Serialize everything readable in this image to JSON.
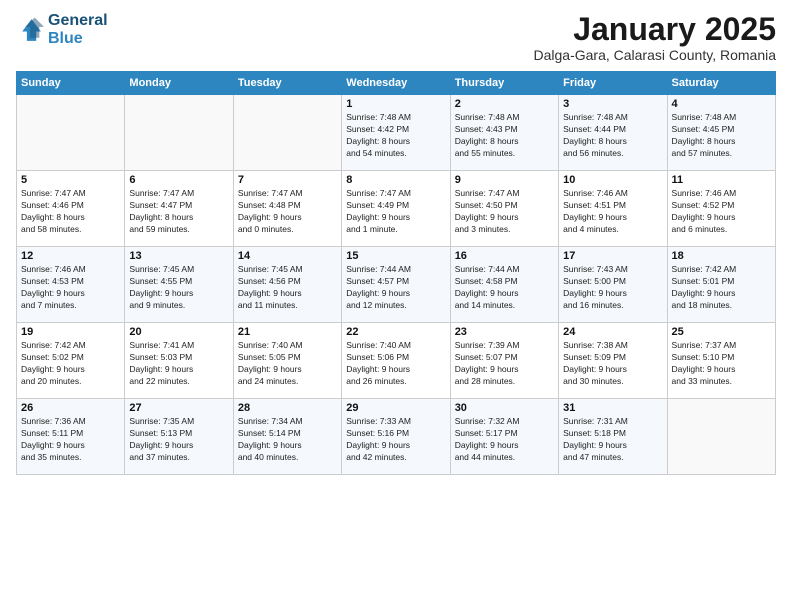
{
  "header": {
    "logo_line1": "General",
    "logo_line2": "Blue",
    "month": "January 2025",
    "location": "Dalga-Gara, Calarasi County, Romania"
  },
  "weekdays": [
    "Sunday",
    "Monday",
    "Tuesday",
    "Wednesday",
    "Thursday",
    "Friday",
    "Saturday"
  ],
  "weeks": [
    [
      {
        "day": "",
        "info": ""
      },
      {
        "day": "",
        "info": ""
      },
      {
        "day": "",
        "info": ""
      },
      {
        "day": "1",
        "info": "Sunrise: 7:48 AM\nSunset: 4:42 PM\nDaylight: 8 hours\nand 54 minutes."
      },
      {
        "day": "2",
        "info": "Sunrise: 7:48 AM\nSunset: 4:43 PM\nDaylight: 8 hours\nand 55 minutes."
      },
      {
        "day": "3",
        "info": "Sunrise: 7:48 AM\nSunset: 4:44 PM\nDaylight: 8 hours\nand 56 minutes."
      },
      {
        "day": "4",
        "info": "Sunrise: 7:48 AM\nSunset: 4:45 PM\nDaylight: 8 hours\nand 57 minutes."
      }
    ],
    [
      {
        "day": "5",
        "info": "Sunrise: 7:47 AM\nSunset: 4:46 PM\nDaylight: 8 hours\nand 58 minutes."
      },
      {
        "day": "6",
        "info": "Sunrise: 7:47 AM\nSunset: 4:47 PM\nDaylight: 8 hours\nand 59 minutes."
      },
      {
        "day": "7",
        "info": "Sunrise: 7:47 AM\nSunset: 4:48 PM\nDaylight: 9 hours\nand 0 minutes."
      },
      {
        "day": "8",
        "info": "Sunrise: 7:47 AM\nSunset: 4:49 PM\nDaylight: 9 hours\nand 1 minute."
      },
      {
        "day": "9",
        "info": "Sunrise: 7:47 AM\nSunset: 4:50 PM\nDaylight: 9 hours\nand 3 minutes."
      },
      {
        "day": "10",
        "info": "Sunrise: 7:46 AM\nSunset: 4:51 PM\nDaylight: 9 hours\nand 4 minutes."
      },
      {
        "day": "11",
        "info": "Sunrise: 7:46 AM\nSunset: 4:52 PM\nDaylight: 9 hours\nand 6 minutes."
      }
    ],
    [
      {
        "day": "12",
        "info": "Sunrise: 7:46 AM\nSunset: 4:53 PM\nDaylight: 9 hours\nand 7 minutes."
      },
      {
        "day": "13",
        "info": "Sunrise: 7:45 AM\nSunset: 4:55 PM\nDaylight: 9 hours\nand 9 minutes."
      },
      {
        "day": "14",
        "info": "Sunrise: 7:45 AM\nSunset: 4:56 PM\nDaylight: 9 hours\nand 11 minutes."
      },
      {
        "day": "15",
        "info": "Sunrise: 7:44 AM\nSunset: 4:57 PM\nDaylight: 9 hours\nand 12 minutes."
      },
      {
        "day": "16",
        "info": "Sunrise: 7:44 AM\nSunset: 4:58 PM\nDaylight: 9 hours\nand 14 minutes."
      },
      {
        "day": "17",
        "info": "Sunrise: 7:43 AM\nSunset: 5:00 PM\nDaylight: 9 hours\nand 16 minutes."
      },
      {
        "day": "18",
        "info": "Sunrise: 7:42 AM\nSunset: 5:01 PM\nDaylight: 9 hours\nand 18 minutes."
      }
    ],
    [
      {
        "day": "19",
        "info": "Sunrise: 7:42 AM\nSunset: 5:02 PM\nDaylight: 9 hours\nand 20 minutes."
      },
      {
        "day": "20",
        "info": "Sunrise: 7:41 AM\nSunset: 5:03 PM\nDaylight: 9 hours\nand 22 minutes."
      },
      {
        "day": "21",
        "info": "Sunrise: 7:40 AM\nSunset: 5:05 PM\nDaylight: 9 hours\nand 24 minutes."
      },
      {
        "day": "22",
        "info": "Sunrise: 7:40 AM\nSunset: 5:06 PM\nDaylight: 9 hours\nand 26 minutes."
      },
      {
        "day": "23",
        "info": "Sunrise: 7:39 AM\nSunset: 5:07 PM\nDaylight: 9 hours\nand 28 minutes."
      },
      {
        "day": "24",
        "info": "Sunrise: 7:38 AM\nSunset: 5:09 PM\nDaylight: 9 hours\nand 30 minutes."
      },
      {
        "day": "25",
        "info": "Sunrise: 7:37 AM\nSunset: 5:10 PM\nDaylight: 9 hours\nand 33 minutes."
      }
    ],
    [
      {
        "day": "26",
        "info": "Sunrise: 7:36 AM\nSunset: 5:11 PM\nDaylight: 9 hours\nand 35 minutes."
      },
      {
        "day": "27",
        "info": "Sunrise: 7:35 AM\nSunset: 5:13 PM\nDaylight: 9 hours\nand 37 minutes."
      },
      {
        "day": "28",
        "info": "Sunrise: 7:34 AM\nSunset: 5:14 PM\nDaylight: 9 hours\nand 40 minutes."
      },
      {
        "day": "29",
        "info": "Sunrise: 7:33 AM\nSunset: 5:16 PM\nDaylight: 9 hours\nand 42 minutes."
      },
      {
        "day": "30",
        "info": "Sunrise: 7:32 AM\nSunset: 5:17 PM\nDaylight: 9 hours\nand 44 minutes."
      },
      {
        "day": "31",
        "info": "Sunrise: 7:31 AM\nSunset: 5:18 PM\nDaylight: 9 hours\nand 47 minutes."
      },
      {
        "day": "",
        "info": ""
      }
    ]
  ]
}
